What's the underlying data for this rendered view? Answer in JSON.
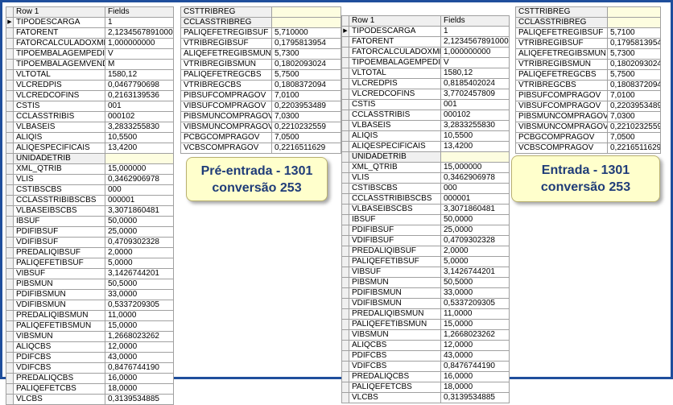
{
  "header": {
    "row": "Row 1",
    "fields": "Fields"
  },
  "left": {
    "main_rows": [
      [
        "TIPODESCARGA",
        "1"
      ],
      [
        "FATORENT",
        "2,123456789100000"
      ],
      [
        "FATORCALCULADOXML",
        "1,000000000"
      ],
      [
        "TIPOEMBALAGEMPEDIDO",
        "V"
      ],
      [
        "TIPOEMBALAGEMVENDA",
        "M"
      ],
      [
        "VLTOTAL",
        "1580,12"
      ],
      [
        "VLCREDPIS",
        "0,0467790698"
      ],
      [
        "VLCREDCOFINS",
        "0,2163139536"
      ],
      [
        "CSTIS",
        "001"
      ],
      [
        "CCLASSTRIBIS",
        "000102"
      ],
      [
        "VLBASEIS",
        "3,2833255830"
      ],
      [
        "ALIQIS",
        "10,5500"
      ],
      [
        "ALIQESPECIFICAIS",
        "13,4200"
      ],
      [
        "UNIDADETRIB",
        ""
      ],
      [
        "XML_QTRIB",
        "15,000000"
      ],
      [
        "VLIS",
        "0,3462906978"
      ],
      [
        "CSTIBSCBS",
        "000"
      ],
      [
        "CCLASSTRIBIBSCBS",
        "000001"
      ],
      [
        "VLBASEIBSCBS",
        "3,3071860481"
      ],
      [
        "IBSUF",
        "50,0000"
      ],
      [
        "PDIFIBSUF",
        "25,0000"
      ],
      [
        "VDIFIBSUF",
        "0,4709302328"
      ],
      [
        "PREDALIQIBSUF",
        "2,0000"
      ],
      [
        "PALIQEFETIBSUF",
        "5,0000"
      ],
      [
        "VIBSUF",
        "3,1426744201"
      ],
      [
        "PIBSMUN",
        "50,5000"
      ],
      [
        "PDIFIBSMUN",
        "33,0000"
      ],
      [
        "VDIFIBSMUN",
        "0,5337209305"
      ],
      [
        "PREDALIQIBSMUN",
        "11,0000"
      ],
      [
        "PALIQEFETIBSMUN",
        "15,0000"
      ],
      [
        "VIBSMUN",
        "1,2668023262"
      ],
      [
        "ALIQCBS",
        "12,0000"
      ],
      [
        "PDIFCBS",
        "43,0000"
      ],
      [
        "VDIFCBS",
        "0,8476744190"
      ],
      [
        "PREDALIQCBS",
        "16,0000"
      ],
      [
        "PALIQEFETCBS",
        "18,0000"
      ],
      [
        "VLCBS",
        "0,3139534885"
      ]
    ],
    "side_rows": [
      [
        "CSTTRIBREG",
        ""
      ],
      [
        "CCLASSTRIBREG",
        ""
      ],
      [
        "PALIQEFETREGIBSUF",
        "5,710000"
      ],
      [
        "VTRIBREGIBSUF",
        "0,1795813954"
      ],
      [
        "ALIQEFETREGIBSMUN",
        "5,7300"
      ],
      [
        "VTRIBREGIBSMUN",
        "0,1802093024"
      ],
      [
        "PALIQEFETREGCBS",
        "5,7500"
      ],
      [
        "VTRIBREGCBS",
        "0,1808372094"
      ],
      [
        "PIBSUFCOMPRAGOV",
        "7,0100"
      ],
      [
        "VIBSUFCOMPRAGOV",
        "0,2203953489"
      ],
      [
        "PIBSMUNCOMPRAGOV",
        "7,0300"
      ],
      [
        "VIBSMUNCOMPRAGOV",
        "0,2210232559"
      ],
      [
        "PCBGCOMPRAGOV",
        "7,0500"
      ],
      [
        "VCBSCOMPRAGOV",
        "0,2216511629"
      ]
    ],
    "callout_line1": "Pré-entrada - 1301",
    "callout_line2": "conversão 253"
  },
  "right": {
    "main_rows": [
      [
        "TIPODESCARGA",
        "1"
      ],
      [
        "FATORENT",
        "2,123456789100000"
      ],
      [
        "FATORCALCULADOXML",
        "1,000000000"
      ],
      [
        "TIPOEMBALAGEMPEDIDO",
        "V"
      ],
      [
        "VLTOTAL",
        "1580,12"
      ],
      [
        "VLCREDPIS",
        "0,8185402024"
      ],
      [
        "VLCREDCOFINS",
        "3,7702457809"
      ],
      [
        "CSTIS",
        "001"
      ],
      [
        "CCLASSTRIBIS",
        "000102"
      ],
      [
        "VLBASEIS",
        "3,2833255830"
      ],
      [
        "ALIQIS",
        "10,5500"
      ],
      [
        "ALIQESPECIFICAIS",
        "13,4200"
      ],
      [
        "UNIDADETRIB",
        ""
      ],
      [
        "XML_QTRIB",
        "15,000000"
      ],
      [
        "VLIS",
        "0,3462906978"
      ],
      [
        "CSTIBSCBS",
        "000"
      ],
      [
        "CCLASSTRIBIBSCBS",
        "000001"
      ],
      [
        "VLBASEIBSCBS",
        "3,3071860481"
      ],
      [
        "IBSUF",
        "50,0000"
      ],
      [
        "PDIFIBSUF",
        "25,0000"
      ],
      [
        "VDIFIBSUF",
        "0,4709302328"
      ],
      [
        "PREDALIQIBSUF",
        "2,0000"
      ],
      [
        "PALIQEFETIBSUF",
        "5,0000"
      ],
      [
        "VIBSUF",
        "3,1426744201"
      ],
      [
        "PIBSMUN",
        "50,5000"
      ],
      [
        "PDIFIBSMUN",
        "33,0000"
      ],
      [
        "VDIFIBSMUN",
        "0,5337209305"
      ],
      [
        "PREDALIQIBSMUN",
        "11,0000"
      ],
      [
        "PALIQEFETIBSMUN",
        "15,0000"
      ],
      [
        "VIBSMUN",
        "1,2668023262"
      ],
      [
        "ALIQCBS",
        "12,0000"
      ],
      [
        "PDIFCBS",
        "43,0000"
      ],
      [
        "VDIFCBS",
        "0,8476744190"
      ],
      [
        "PREDALIQCBS",
        "16,0000"
      ],
      [
        "PALIQEFETCBS",
        "18,0000"
      ],
      [
        "VLCBS",
        "0,3139534885"
      ]
    ],
    "side_rows": [
      [
        "CSTTRIBREG",
        ""
      ],
      [
        "CCLASSTRIBREG",
        ""
      ],
      [
        "PALIQEFETREGIBSUF",
        "5,7100"
      ],
      [
        "VTRIBREGIBSUF",
        "0,1795813954"
      ],
      [
        "ALIQEFETREGIBSMUN",
        "5,7300"
      ],
      [
        "VTRIBREGIBSMUN",
        "0,1802093024"
      ],
      [
        "PALIQEFETREGCBS",
        "5,7500"
      ],
      [
        "VTRIBREGCBS",
        "0,1808372094"
      ],
      [
        "PIBSUFCOMPRAGOV",
        "7,0100"
      ],
      [
        "VIBSUFCOMPRAGOV",
        "0,2203953489"
      ],
      [
        "PIBSMUNCOMPRAGOV",
        "7,0300"
      ],
      [
        "VIBSMUNCOMPRAGOV",
        "0,2210232559"
      ],
      [
        "PCBGCOMPRAGOV",
        "7,0500"
      ],
      [
        "VCBSCOMPRAGOV",
        "0,2216511629"
      ]
    ],
    "callout_line1": "Entrada - 1301",
    "callout_line2": "conversão 253"
  }
}
